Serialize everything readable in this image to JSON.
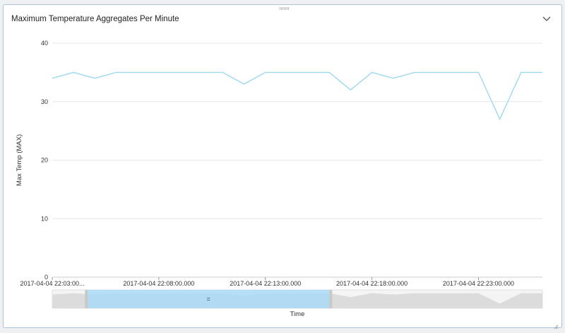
{
  "panel": {
    "title": "Maximum Temperature Aggregates Per Minute"
  },
  "icons": {
    "collapse": "chevron-down-icon",
    "drag": "drag-handle-icon",
    "resize": "resize-corner-icon"
  },
  "colors": {
    "line": "#9fd8ee",
    "brush_selection": "#a9daf7",
    "brush_background": "#dcdcdc",
    "grid": "#e6e6e6"
  },
  "chart_data": {
    "type": "line",
    "title": "Maximum Temperature Aggregates Per Minute",
    "xlabel": "Time",
    "ylabel": "Max Temp (MAX)",
    "ylim": [
      0,
      40
    ],
    "yticks": [
      0,
      10,
      20,
      30,
      40
    ],
    "xlim": [
      "2017-04-04 22:03:00",
      "2017-04-04 22:26:00"
    ],
    "xticks": [
      {
        "t": "2017-04-04 22:03:00",
        "label": "2017-04-04 22:03:00..."
      },
      {
        "t": "2017-04-04 22:08:00",
        "label": "2017-04-04 22:08:00.000"
      },
      {
        "t": "2017-04-04 22:13:00",
        "label": "2017-04-04 22:13:00.000"
      },
      {
        "t": "2017-04-04 22:18:00",
        "label": "2017-04-04 22:18:00.000"
      },
      {
        "t": "2017-04-04 22:23:00",
        "label": "2017-04-04 22:23:00.000"
      }
    ],
    "grid": true,
    "series": [
      {
        "x": [
          "2017-04-04 22:03:00",
          "2017-04-04 22:04:00",
          "2017-04-04 22:05:00",
          "2017-04-04 22:06:00",
          "2017-04-04 22:07:00",
          "2017-04-04 22:08:00",
          "2017-04-04 22:09:00",
          "2017-04-04 22:10:00",
          "2017-04-04 22:11:00",
          "2017-04-04 22:12:00",
          "2017-04-04 22:13:00",
          "2017-04-04 22:14:00",
          "2017-04-04 22:15:00",
          "2017-04-04 22:16:00",
          "2017-04-04 22:17:00",
          "2017-04-04 22:18:00",
          "2017-04-04 22:19:00",
          "2017-04-04 22:20:00",
          "2017-04-04 22:21:00",
          "2017-04-04 22:22:00",
          "2017-04-04 22:23:00",
          "2017-04-04 22:24:00",
          "2017-04-04 22:25:00",
          "2017-04-04 22:26:00"
        ],
        "values": [
          34,
          35,
          34,
          35,
          35,
          35,
          35,
          35,
          35,
          33,
          35,
          35,
          35,
          35,
          32,
          35,
          34,
          35,
          35,
          35,
          35,
          27,
          35,
          35
        ]
      }
    ],
    "brush": {
      "selection_start": "2017-04-04 22:04:40",
      "selection_end": "2017-04-04 22:16:00",
      "handle_label": "="
    }
  }
}
